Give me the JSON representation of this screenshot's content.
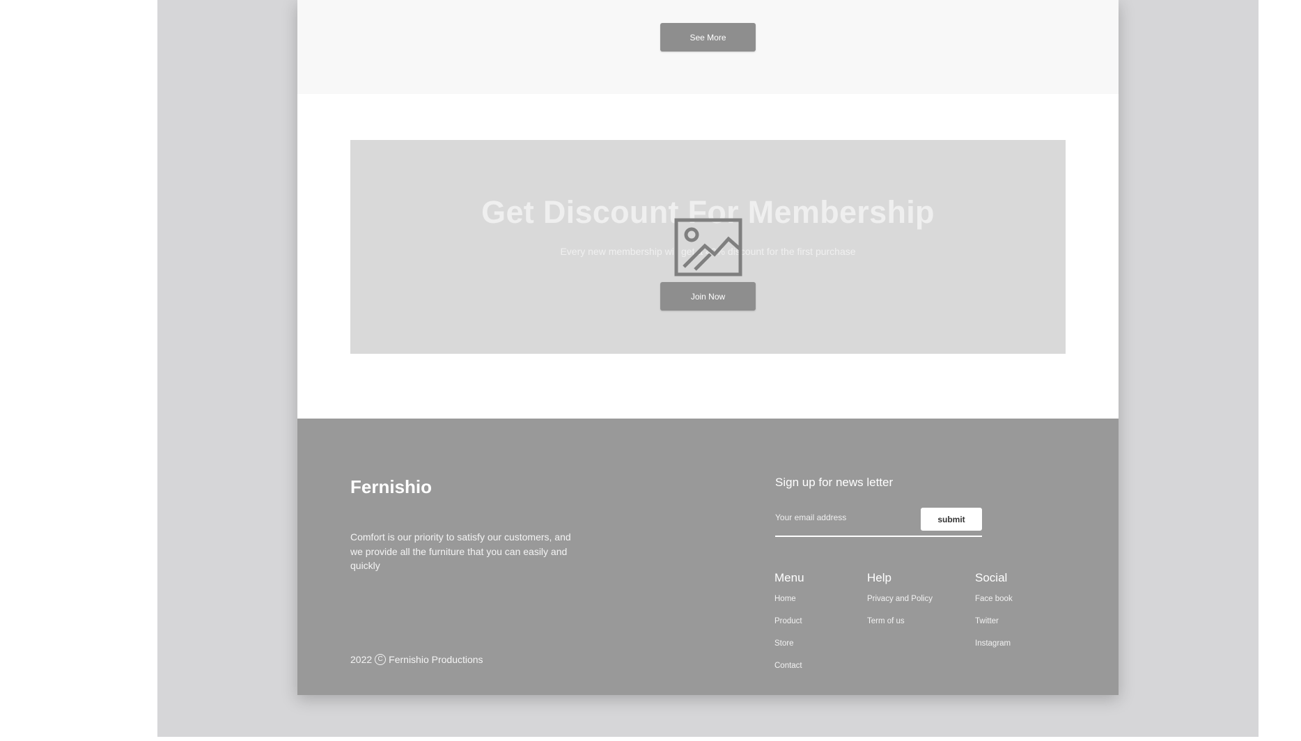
{
  "top": {
    "see_more_label": "See More"
  },
  "banner": {
    "title": "Get Discount For Membership",
    "subtitle": "Every new membership will get a 40% discount for the first purchase",
    "image_icon": "image-placeholder-icon",
    "join_label": "Join Now"
  },
  "footer": {
    "brand": "Fernishio",
    "description": "Comfort is our priority to satisfy our customers, and we provide all the furniture that you can easily and quickly",
    "copyright_year": "2022",
    "copyright_symbol": "C",
    "copyright_name": "Fernishio Productions",
    "newsletter": {
      "title": "Sign up for news letter",
      "placeholder": "Your email address",
      "submit_label": "submit"
    },
    "columns": {
      "menu": {
        "title": "Menu",
        "items": [
          "Home",
          "Product",
          "Store",
          "Contact"
        ]
      },
      "help": {
        "title": "Help",
        "items": [
          "Privacy and Policy",
          "Term of us"
        ]
      },
      "social": {
        "title": "Social",
        "items": [
          "Face book",
          "Twitter",
          "Instagram"
        ]
      }
    }
  },
  "colors": {
    "canvas_bg": "#d6d6d8",
    "button_gray": "#8e8e8e",
    "banner_bg": "#d9d9d9",
    "footer_bg": "#999999"
  }
}
